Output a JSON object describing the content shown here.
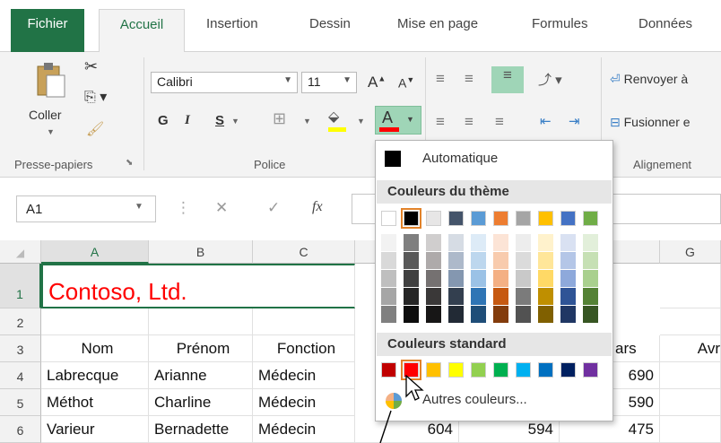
{
  "tabs": [
    "Fichier",
    "Accueil",
    "Insertion",
    "Dessin",
    "Mise en page",
    "Formules",
    "Données"
  ],
  "clipboard": {
    "paste_label": "Coller",
    "group_label": "Presse-papiers"
  },
  "font": {
    "name": "Calibri",
    "size": "11",
    "grow_label": "A",
    "shrink_label": "A",
    "bold_label": "G",
    "italic_label": "I",
    "underline_label": "S",
    "font_color_label": "A",
    "group_label": "Police"
  },
  "alignment": {
    "wrap_label": "Renvoyer à",
    "merge_label": "Fusionner e",
    "group_label": "Alignement"
  },
  "formula_bar": {
    "name_box": "A1",
    "fx_label": "fx"
  },
  "columns": [
    "A",
    "B",
    "C",
    "G"
  ],
  "rows": [
    "1",
    "2",
    "3",
    "4",
    "5",
    "6"
  ],
  "cells": {
    "title": "Contoso, Ltd.",
    "headers": [
      "Nom",
      "Prénom",
      "Fonction",
      "ars",
      "Avr"
    ],
    "data": [
      [
        "Labrecque",
        "Arianne",
        "Médecin",
        "690"
      ],
      [
        "Méthot",
        "Charline",
        "Médecin",
        "590"
      ],
      [
        "Varieur",
        "Bernadette",
        "Médecin",
        "604",
        "594",
        "475"
      ]
    ]
  },
  "color_menu": {
    "automatic_label": "Automatique",
    "theme_heading": "Couleurs du thème",
    "standard_heading": "Couleurs standard",
    "more_colors_label": "Autres couleurs...",
    "theme_colors": [
      "#ffffff",
      "#000000",
      "#e7e6e6",
      "#44546a",
      "#5b9bd5",
      "#ed7d31",
      "#a5a5a5",
      "#ffc000",
      "#4472c4",
      "#70ad47"
    ],
    "theme_shades": [
      [
        "#f2f2f2",
        "#d9d9d9",
        "#bfbfbf",
        "#a6a6a6",
        "#808080"
      ],
      [
        "#7f7f7f",
        "#595959",
        "#404040",
        "#262626",
        "#0d0d0d"
      ],
      [
        "#d0cece",
        "#aeaaaa",
        "#757171",
        "#3a3838",
        "#171616"
      ],
      [
        "#d6dce4",
        "#adb9ca",
        "#8497b0",
        "#333f4f",
        "#222a35"
      ],
      [
        "#ddebf7",
        "#bdd7ee",
        "#9bc2e6",
        "#2f75b5",
        "#1f4e78"
      ],
      [
        "#fce4d6",
        "#f8cbad",
        "#f4b084",
        "#c65911",
        "#833c0c"
      ],
      [
        "#ededed",
        "#dbdbdb",
        "#c9c9c9",
        "#7b7b7b",
        "#525252"
      ],
      [
        "#fff2cc",
        "#ffe699",
        "#ffd966",
        "#bf8f00",
        "#806000"
      ],
      [
        "#d9e1f2",
        "#b4c6e7",
        "#8ea9db",
        "#2f5496",
        "#203764"
      ],
      [
        "#e2efda",
        "#c6e0b4",
        "#a9d08e",
        "#548235",
        "#375623"
      ]
    ],
    "standard_colors": [
      "#c00000",
      "#ff0000",
      "#ffc000",
      "#ffff00",
      "#92d050",
      "#00b050",
      "#00b0f0",
      "#0070c0",
      "#002060",
      "#7030a0"
    ],
    "accent_font": "#ff0000",
    "accent_fill": "#ffff00"
  }
}
